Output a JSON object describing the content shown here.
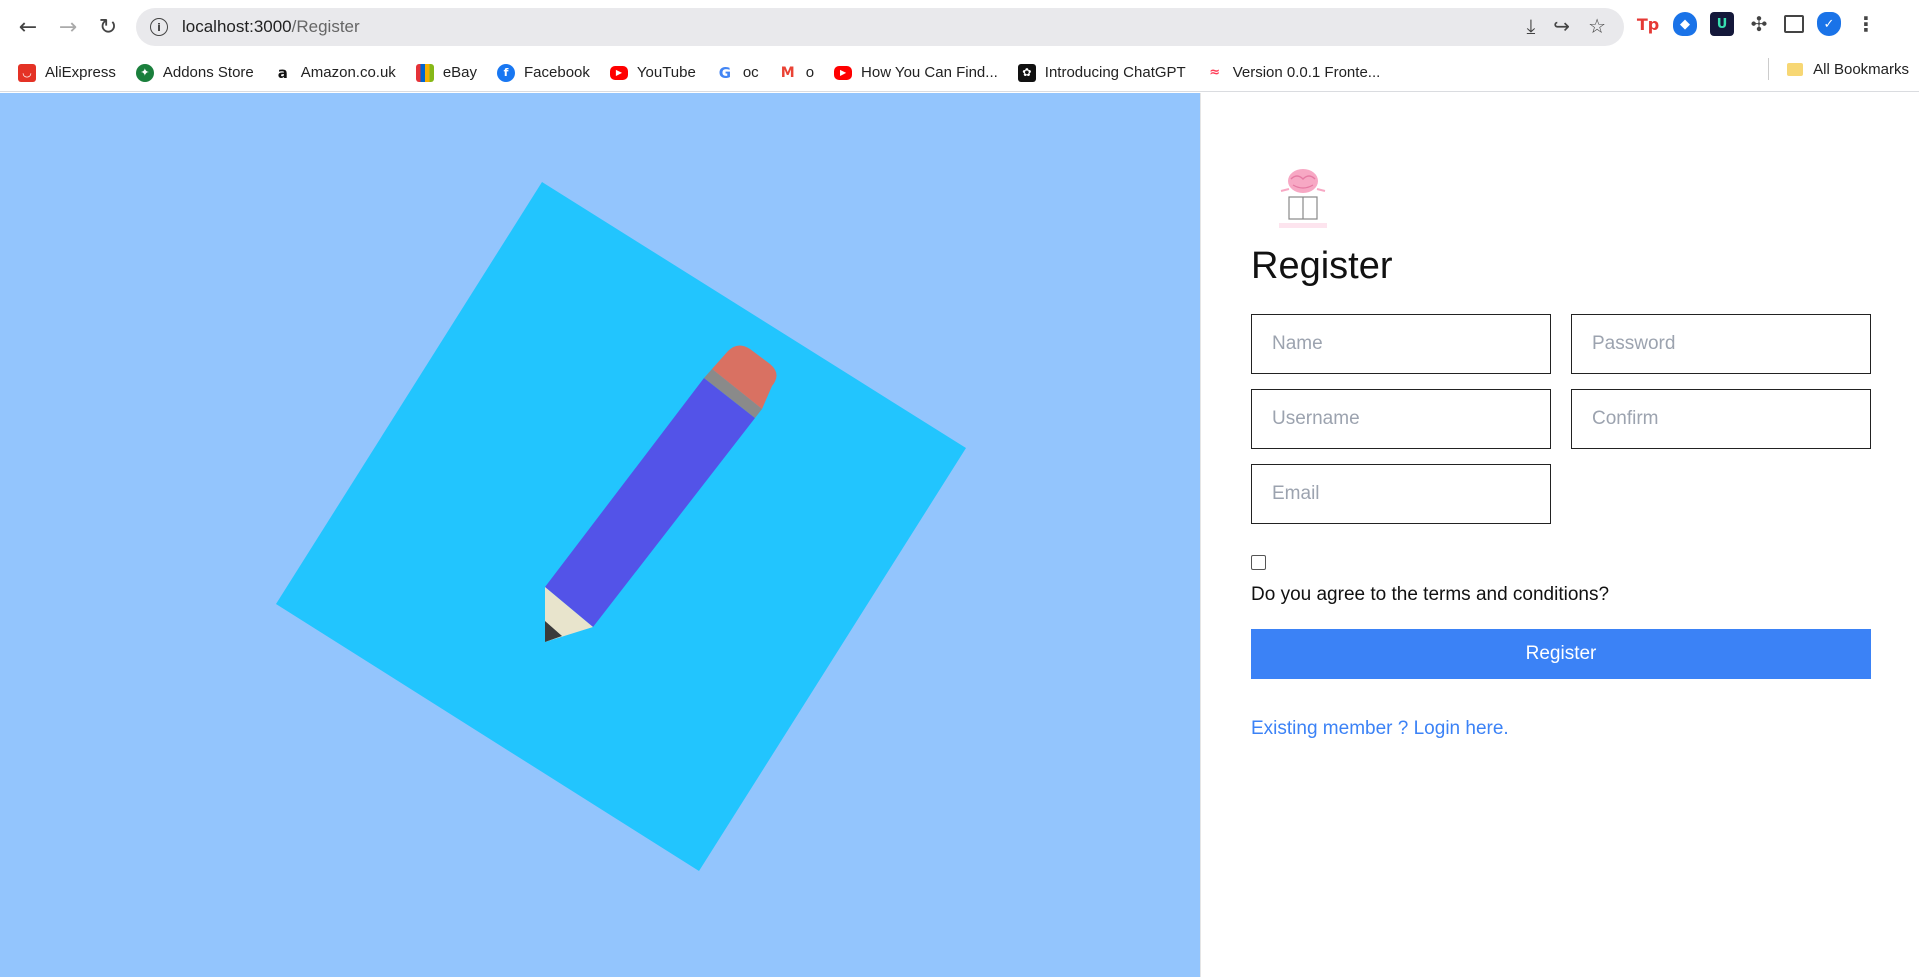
{
  "browser": {
    "url_host": "localhost:3000",
    "url_path": "/Register",
    "nav": {
      "back_icon": "back-arrow-icon",
      "forward_icon": "forward-arrow-icon",
      "reload_icon": "reload-icon"
    }
  },
  "bookmarks": {
    "items": [
      {
        "label": "AliExpress",
        "icon": "aliexpress-icon",
        "color": "#e43225"
      },
      {
        "label": "Addons Store",
        "icon": "addons-icon",
        "color": "#1a7f3c"
      },
      {
        "label": "Amazon.co.uk",
        "icon": "amazon-icon",
        "color": "#ffffff"
      },
      {
        "label": "eBay",
        "icon": "ebay-icon",
        "color": "#0064d2"
      },
      {
        "label": "Facebook",
        "icon": "facebook-icon",
        "color": "#1877f2"
      },
      {
        "label": "YouTube",
        "icon": "youtube-icon",
        "color": "#ff0000"
      },
      {
        "label": "oc",
        "icon": "google-icon",
        "color": "#ffffff"
      },
      {
        "label": "o",
        "icon": "gmail-icon",
        "color": "#ffffff"
      },
      {
        "label": "How You Can Find...",
        "icon": "youtube-icon",
        "color": "#ff0000"
      },
      {
        "label": "Introducing ChatGPT",
        "icon": "chatgpt-icon",
        "color": "#111111"
      },
      {
        "label": "Version 0.0.1 Fronte...",
        "icon": "monday-icon",
        "color": "#ffffff"
      }
    ],
    "all_bookmarks": "All Bookmarks"
  },
  "hero": {
    "background": "#93c5fd",
    "card_color": "#22c5fe",
    "pencil_body": "#5353e8",
    "eraser": "#d97162"
  },
  "form": {
    "title": "Register",
    "name_placeholder": "Name",
    "password_placeholder": "Password",
    "username_placeholder": "Username",
    "confirm_placeholder": "Confirm",
    "email_placeholder": "Email",
    "terms_label": "Do you agree to the terms and conditions?",
    "submit_label": "Register",
    "login_link": "Existing member ? Login here.",
    "accent": "#3b82f6"
  }
}
